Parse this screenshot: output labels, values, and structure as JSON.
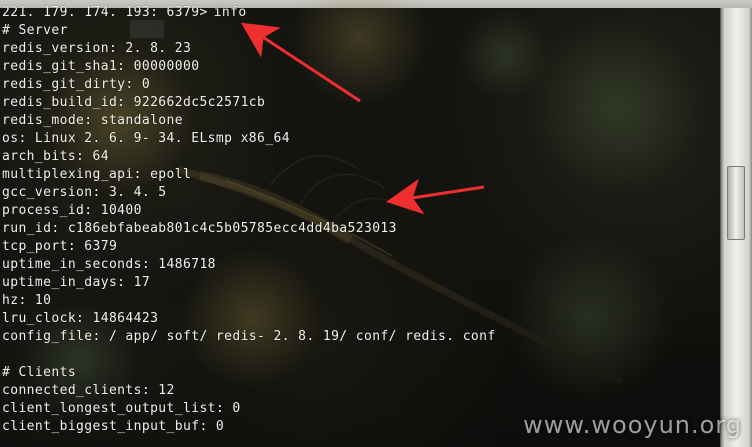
{
  "terminal": {
    "prompt": "221. 179. 174. 193: 6379>",
    "command": "info",
    "lines": [
      "# Server",
      "redis_version: 2. 8. 23",
      "redis_git_sha1: 00000000",
      "redis_git_dirty: 0",
      "redis_build_id: 922662dc5c2571cb",
      "redis_mode: standalone",
      "os: Linux 2. 6. 9- 34. ELsmp x86_64",
      "arch_bits: 64",
      "multiplexing_api: epoll",
      "gcc_version: 3. 4. 5",
      "process_id: 10400",
      "run_id: c186ebfabeab801c4c5b05785ecc4dd4ba523013",
      "tcp_port: 6379",
      "uptime_in_seconds: 1486718",
      "uptime_in_days: 17",
      "hz: 10",
      "lru_clock: 14864423",
      "config_file: / app/ soft/ redis- 2. 8. 19/ conf/ redis. conf",
      "",
      "# Clients",
      "connected_clients: 12",
      "client_longest_output_list: 0",
      "client_biggest_input_buf: 0"
    ]
  },
  "watermark": {
    "text": "www.wooyun.org"
  },
  "colors": {
    "text": "#f2f2ea",
    "arrow": "#ef2f2f"
  }
}
